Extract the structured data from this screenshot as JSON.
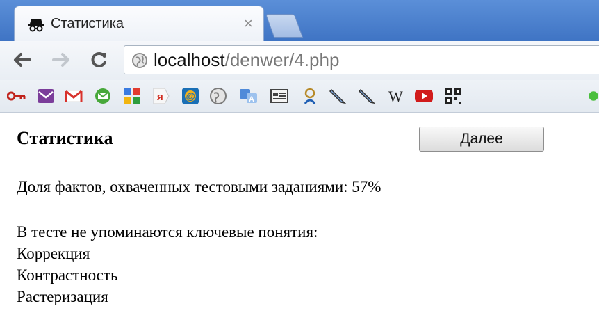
{
  "browser": {
    "tab": {
      "title": "Статистика",
      "close_glyph": "×",
      "favicon": "spy-hat-icon"
    },
    "address_bar": {
      "host": "localhost",
      "path": "/denwer/4.php"
    },
    "bookmarks": [
      "key-icon",
      "mail-icon",
      "gmail-icon",
      "email-icon",
      "puzzle-icon",
      "yandex-icon",
      "at-icon",
      "globe-icon",
      "translate-icon",
      "card-icon",
      "person-icon",
      "pencil-icon",
      "pencil-icon",
      "wikipedia-icon",
      "youtube-icon",
      "qr-icon",
      "green-icon"
    ],
    "colors": {
      "tabstrip": "#4a7fcf",
      "youtube": "#d11b1b",
      "gmail": "#d8322c"
    }
  },
  "page": {
    "title": "Статистика",
    "next_button": "Далее",
    "coverage": {
      "label": "Доля фактов, охваченных тестовыми заданиями:",
      "value": "57%"
    },
    "missing_heading": "В тесте не упоминаются ключевые понятия:",
    "missing_concepts": [
      "Коррекция",
      "Контрастность",
      "Растеризация"
    ]
  }
}
